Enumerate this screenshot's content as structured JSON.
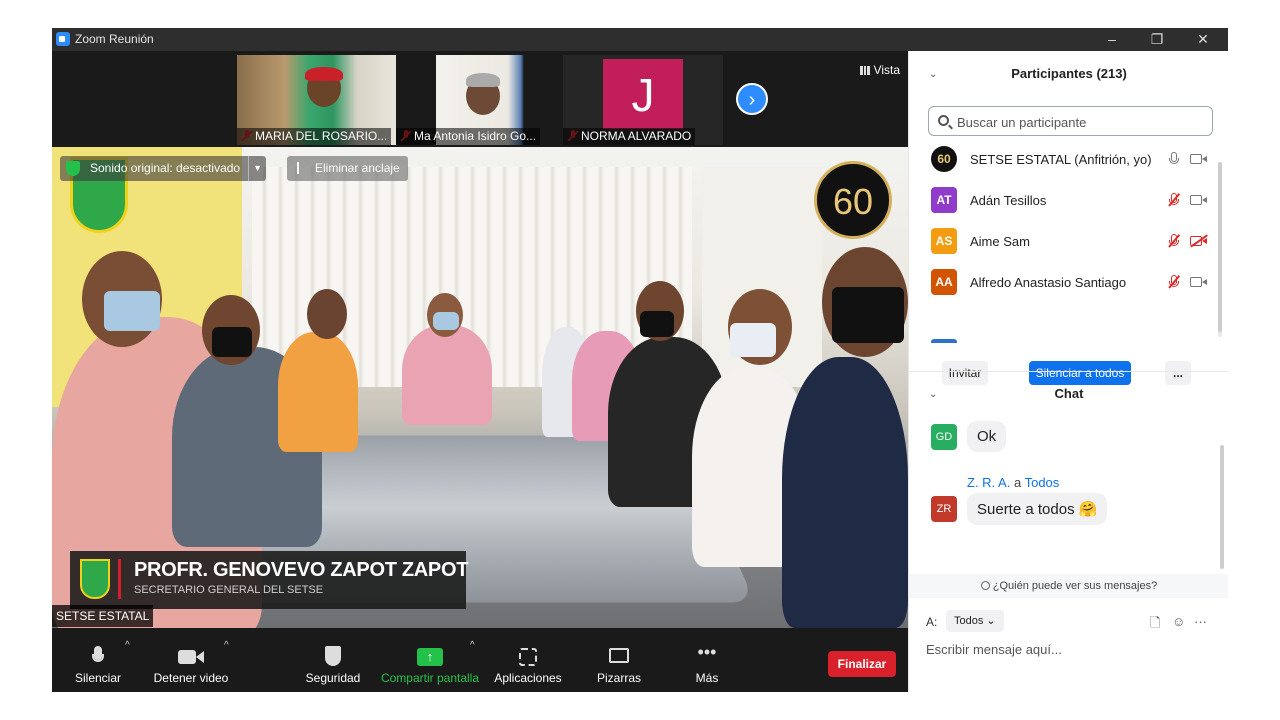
{
  "window": {
    "title": "Zoom Reunión",
    "minimize": "–",
    "restore": "❐",
    "close": "✕"
  },
  "strip": {
    "participants": [
      {
        "name": "MARIA DEL ROSARIO..."
      },
      {
        "name": "Ma Antonia Isidro Go..."
      },
      {
        "name": "NORMA ALVARADO",
        "initial": "J"
      }
    ],
    "next_label": "›",
    "view_label": "Vista"
  },
  "video": {
    "sound_notice": "Sonido original: desactivado",
    "unpin_label": "Eliminar anclaje",
    "badge_text": "60",
    "lower_third_name": "PROFR. GENOVEVO ZAPOT ZAPOT",
    "lower_third_title": "SECRETARIO GENERAL DEL SETSE",
    "speaker_tag": "SETSE ESTATAL"
  },
  "toolbar": {
    "mute": "Silenciar",
    "video": "Detener video",
    "security": "Seguridad",
    "share": "Compartir pantalla",
    "apps": "Aplicaciones",
    "whiteboards": "Pizarras",
    "more": "Más",
    "end": "Finalizar",
    "colors": {
      "share_green": "#23c14a",
      "end_red": "#d9212b"
    }
  },
  "participants": {
    "title": "Participantes (213)",
    "search_placeholder": "Buscar un participante",
    "list": [
      {
        "initials": "60",
        "name": "SETSE ESTATAL (Anfitrión, yo)",
        "color": "#111111",
        "mic": "on",
        "cam": "on"
      },
      {
        "initials": "AT",
        "name": "Adán Tesillos",
        "color": "#8e3cc9",
        "mic": "off",
        "cam": "on"
      },
      {
        "initials": "AS",
        "name": "Aime Sam",
        "color": "#f39c12",
        "mic": "off",
        "cam": "off"
      },
      {
        "initials": "AA",
        "name": "Alfredo Anastasio Santiago",
        "color": "#d35400",
        "mic": "off",
        "cam": "on"
      }
    ],
    "invite": "Invitar",
    "mute_all": "Silenciar a todos",
    "more": "..."
  },
  "chat": {
    "title": "Chat",
    "messages": [
      {
        "initials": "GD",
        "color": "#27ae60",
        "text": "Ok"
      },
      {
        "initials": "ZR",
        "color": "#c0392b",
        "sender": "Z. R. A.",
        "to_word": "a",
        "recipient": "Todos",
        "text": "Suerte a todos 🤗"
      }
    ],
    "who_can_see": "¿Quién puede ver sus mensajes?",
    "to_label": "A:",
    "to_value": "Todos",
    "message_placeholder": "Escribir mensaje aquí..."
  }
}
